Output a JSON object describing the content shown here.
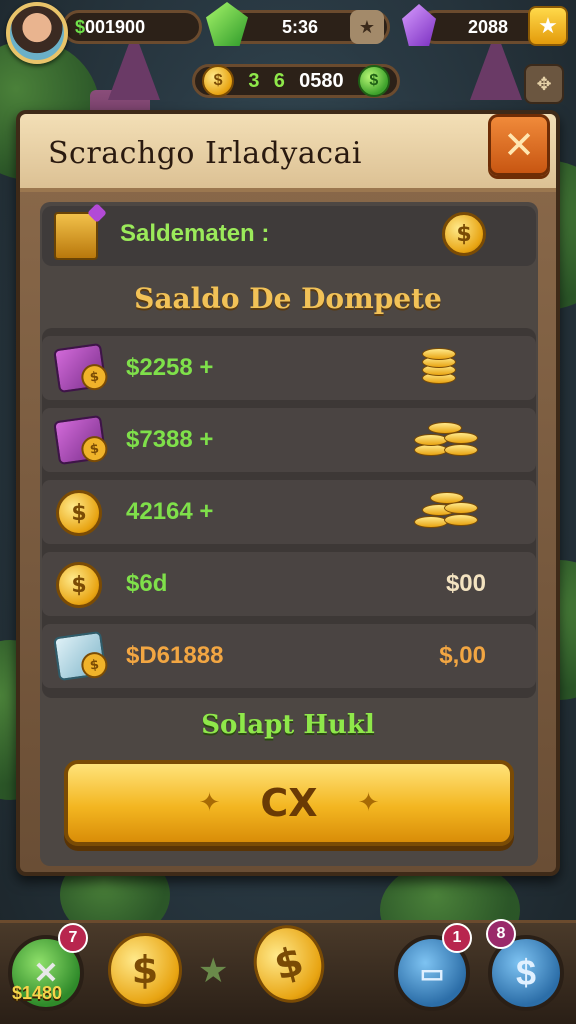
{
  "hud": {
    "cash": "$001900",
    "timer": "5:36",
    "gems": "2088",
    "coins_a": "3",
    "coins_b": "6",
    "coins_c": "0580"
  },
  "panel": {
    "title": "Scrachgo Irladyacai",
    "close_label": "✕",
    "balance_label": "Saldematen :",
    "section_title": "Saaldo De Dompete",
    "transactions": [
      {
        "amount": "$2258 +",
        "value": "",
        "amount_color": "#7fe04a"
      },
      {
        "amount": "$7388 +",
        "value": "",
        "amount_color": "#7fe04a"
      },
      {
        "amount": "42164 +",
        "value": "",
        "amount_color": "#7fe04a"
      },
      {
        "amount": "$6d",
        "value": "$00",
        "amount_color": "#7fe04a"
      },
      {
        "amount": "$D61888",
        "value": "$,00",
        "amount_color": "#f2a642"
      }
    ],
    "cta_heading": "Solapt Hukl",
    "cta_label": "CX"
  },
  "bottom": {
    "left_badge": "7",
    "left_label": "$1480",
    "right_badge_1": "1",
    "right_badge_2": "8"
  },
  "colors": {
    "accent_gold": "#f3b621",
    "accent_green": "#7fe04a",
    "close_orange": "#e06a20"
  }
}
